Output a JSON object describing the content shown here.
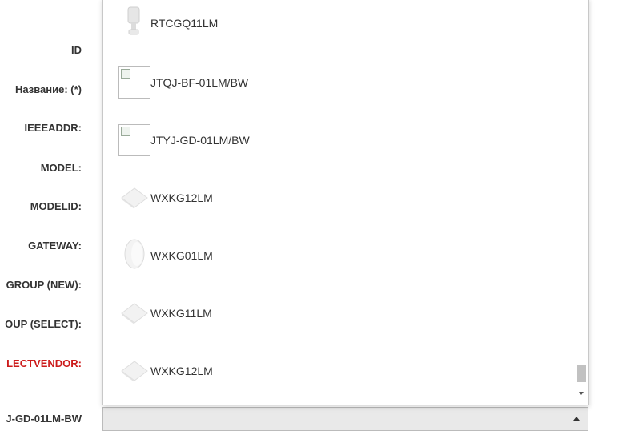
{
  "form": {
    "labels": {
      "id": "ID",
      "name": "Название: (*)",
      "ieeeaddr": "IEEEADDR:",
      "model": "MODEL:",
      "modelid": "MODELID:",
      "gateway": "GATEWAY:",
      "group_new": "GROUP (NEW):",
      "group_select": "OUP (SELECT):",
      "selectvendor": "LECTVENDOR:",
      "selected_model": "J-GD-01LM-BW"
    }
  },
  "colors": {
    "required_label": "#cc1b1b",
    "select_bg": "#e9e9e9"
  },
  "dropdown": {
    "options": [
      {
        "name": "RTCGQ11LM",
        "icon": "sensor-pole-icon"
      },
      {
        "name": "JTQJ-BF-01LM/BW",
        "icon": "broken-image-icon"
      },
      {
        "name": "JTYJ-GD-01LM/BW",
        "icon": "broken-image-icon"
      },
      {
        "name": "WXKG12LM",
        "icon": "square-button-icon"
      },
      {
        "name": "WXKG01LM",
        "icon": "round-button-icon"
      },
      {
        "name": "WXKG11LM",
        "icon": "square-button-icon"
      },
      {
        "name": "WXKG12LM",
        "icon": "square-button-icon"
      }
    ]
  }
}
